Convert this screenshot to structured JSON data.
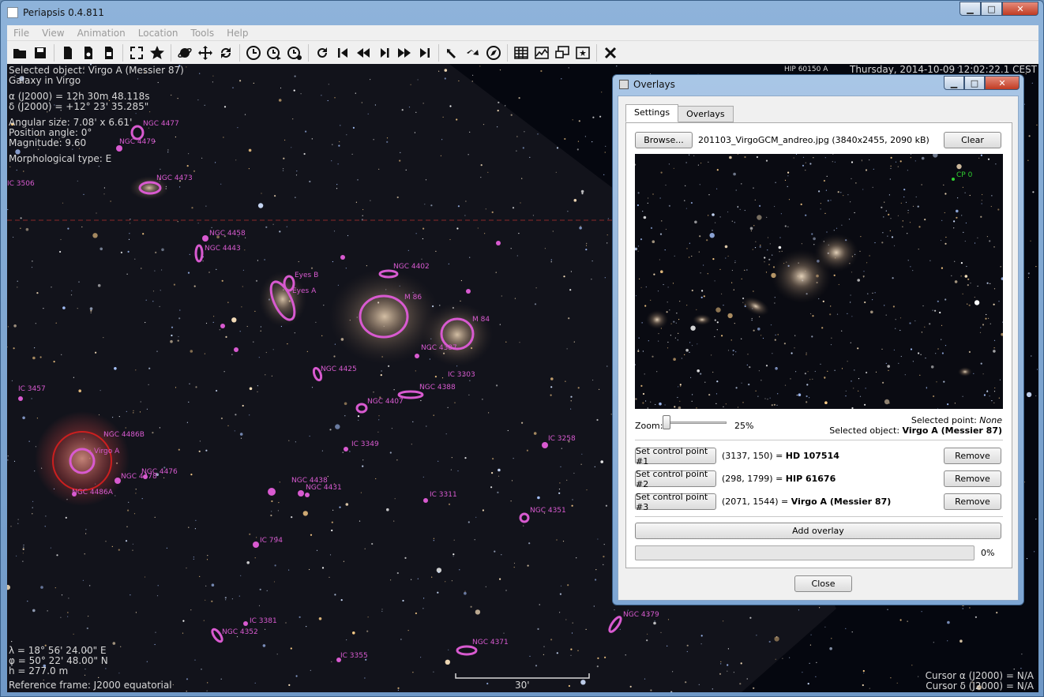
{
  "window": {
    "title": "Periapsis 0.4.811"
  },
  "menu": [
    "File",
    "View",
    "Animation",
    "Location",
    "Tools",
    "Help"
  ],
  "toolbar": {
    "groups": [
      [
        "open-icon",
        "save-icon",
        "export-icon",
        "screenshot-icon",
        "export-image-icon",
        "fullscreen-icon",
        "favorite-star-icon"
      ],
      [
        "planet-icon",
        "move-icon",
        "sync-icon"
      ],
      [
        "clock-icon",
        "time-forward-icon",
        "time-settings-icon"
      ],
      [
        "reverse-icon",
        "skip-back-icon",
        "rewind-icon",
        "play-pause-icon",
        "fast-forward-icon",
        "skip-forward-icon"
      ],
      [
        "step-back-icon",
        "step-forward-icon",
        "compass-icon"
      ],
      [
        "table-icon",
        "chart-icon",
        "windows-icon",
        "sky-image-icon"
      ],
      [
        "close-x-icon"
      ]
    ]
  },
  "sky": {
    "info_lines": [
      "Selected object: Virgo A (Messier 87)",
      "Galaxy in Virgo",
      "",
      "α (J2000) = 12h 30m 48.118s",
      "δ (J2000) = +12° 23' 35.285\"",
      "",
      "Angular size: 7.08' x 6.61'",
      "Position angle: 0°",
      "Magnitude: 9.60",
      "",
      "Morphological type: E"
    ],
    "top_right_label": "HIP 60150 A",
    "datetime": "Thursday, 2014-10-09 12:02:22.1 CEST",
    "location_lines": [
      "λ = 18° 56' 24.00\" E",
      "φ = 50° 22' 48.00\" N",
      "h = 277.0 m"
    ],
    "reference_frame": "Reference frame: J2000 equatorial",
    "scale_label": "30'",
    "cursor_ra": "Cursor α (J2000) = N/A",
    "cursor_dec": "Cursor δ (J2000) = N/A",
    "galaxy_labels": [
      "NGC 4477",
      "NGC 4479",
      "NGC 4473",
      "IC 3506",
      "NGC 4458",
      "NGC 4443",
      "Eyes B",
      "Eyes A",
      "NGC 4402",
      "M 86",
      "M 84",
      "NGC 4387",
      "NGC 4425",
      "IC 3303",
      "NGC 4388",
      "NGC 4407",
      "IC 3457",
      "IC 3349",
      "IC 3258",
      "NGC 4486B",
      "Virgo A",
      "NGC 4476",
      "NGC 4478",
      "NGC 4486A",
      "NGC 4438",
      "NGC 4431",
      "IC 3311",
      "NGC 4351",
      "IC 794",
      "IC 3381",
      "NGC 4352",
      "IC 3355",
      "NGC 4371",
      "NGC 4379"
    ]
  },
  "dialog": {
    "title": "Overlays",
    "tabs": [
      "Settings",
      "Overlays"
    ],
    "browse_label": "Browse...",
    "file_info": "201103_VirgoGCM_andreo.jpg (3840x2455, 2090 kB)",
    "clear_label": "Clear",
    "preview_marker": "CP 0",
    "zoom_label": "Zoom:",
    "zoom_value": "25%",
    "zoom_fraction": 0.0,
    "selected_point_label": "Selected point:",
    "selected_point_value": "None",
    "selected_object_label": "Selected object:",
    "selected_object_value": "Virgo A (Messier 87)",
    "control_points": [
      {
        "button": "Set control point #1",
        "coords": "(3137, 150) =",
        "target": "HD 107514",
        "remove": "Remove"
      },
      {
        "button": "Set control point #2",
        "coords": "(298, 1799) =",
        "target": "HIP 61676",
        "remove": "Remove"
      },
      {
        "button": "Set control point #3",
        "coords": "(2071, 1544) =",
        "target": "Virgo A (Messier 87)",
        "remove": "Remove"
      }
    ],
    "add_overlay_label": "Add overlay",
    "progress_value": 0,
    "progress_text": "0%",
    "close_label": "Close"
  },
  "colors": {
    "galaxy_marker": "#d85ad0",
    "selected_marker": "#d02020",
    "cp_marker": "#30d030"
  }
}
